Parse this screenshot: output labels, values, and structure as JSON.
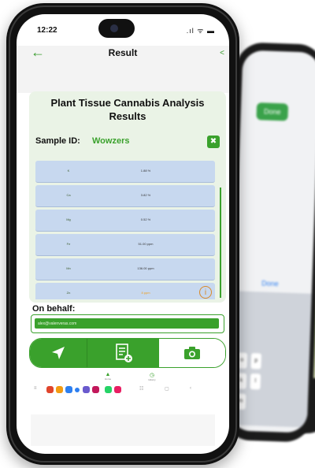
{
  "status": {
    "time": "12:22",
    "icons": ".ıl ᯤ ▬"
  },
  "header": {
    "title": "Result",
    "back_icon": "back-arrow-icon",
    "share_icon": "share-icon"
  },
  "card": {
    "title": "Plant Tissue Cannabis Analysis Results",
    "sample_label": "Sample ID:",
    "sample_value": "Wowzers"
  },
  "results": [
    {
      "element": "K",
      "value": "1.88 %",
      "warn": false
    },
    {
      "element": "Ca",
      "value": "3.82 %",
      "warn": false
    },
    {
      "element": "Mg",
      "value": "0.52 %",
      "warn": false
    },
    {
      "element": "Fe",
      "value": "51.00 ppm",
      "warn": false
    },
    {
      "element": "Mn",
      "value": "136.00 ppm",
      "warn": false
    },
    {
      "element": "Zn",
      "value": "8 ppm",
      "warn": true
    }
  ],
  "behalf": {
    "label": "On behalf:",
    "value": "alex@valenveras.com"
  },
  "actions": [
    {
      "name": "locate",
      "icon": "navigation-arrow-icon"
    },
    {
      "name": "report",
      "icon": "add-report-icon"
    },
    {
      "name": "camera",
      "icon": "camera-icon"
    }
  ],
  "nav": {
    "home": "Home",
    "history": "History"
  },
  "bg_phone": {
    "done_green": "Done",
    "done_blue": "Done",
    "keys": [
      "o",
      "p",
      "k",
      "l",
      "m"
    ]
  },
  "colors": {
    "accent": "#3aa12c",
    "row": "#c7d8ef",
    "card": "#eaf3e6",
    "warning": "#d98a2a"
  }
}
